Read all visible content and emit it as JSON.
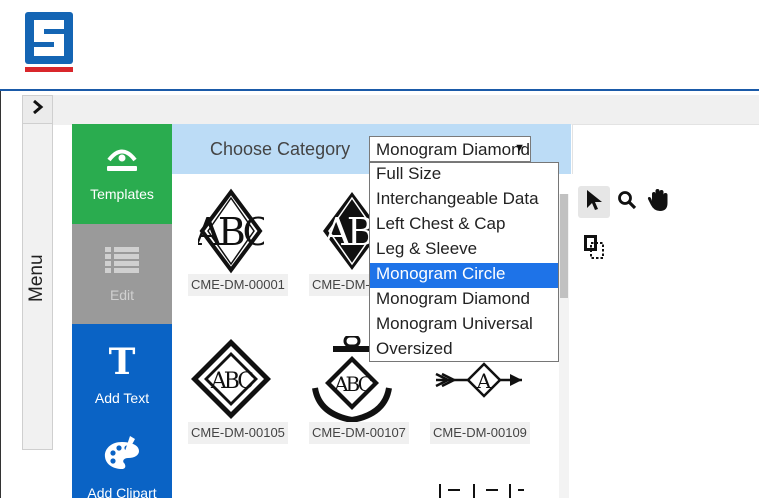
{
  "menu": {
    "label": "Menu"
  },
  "nav": {
    "templates": "Templates",
    "edit": "Edit",
    "add_text": "Add Text",
    "add_clipart": "Add Clipart"
  },
  "panel": {
    "title": "Choose Category",
    "selected_category": "Monogram Diamond"
  },
  "categories": [
    "Full Size",
    "Interchangeable Data",
    "Left Chest & Cap",
    "Leg & Sleeve",
    "Monogram Circle",
    "Monogram Diamond",
    "Monogram Universal",
    "Oversized"
  ],
  "highlighted_category": "Monogram Circle",
  "templates": [
    {
      "code": "CME-DM-00001"
    },
    {
      "code": "CME-DM-00002"
    },
    {
      "code": "CME-DM-00105"
    },
    {
      "code": "CME-DM-00107"
    },
    {
      "code": "CME-DM-00109"
    }
  ],
  "colors": {
    "header_rule": "#1a5aa8",
    "templates_green": "#2aac4f",
    "edit_gray": "#9a9a9a",
    "nav_blue": "#0a63c5",
    "panel_head": "#bcdcf6",
    "highlight": "#1e73e8",
    "logo_blue": "#1465b4",
    "logo_red": "#d9262b"
  }
}
